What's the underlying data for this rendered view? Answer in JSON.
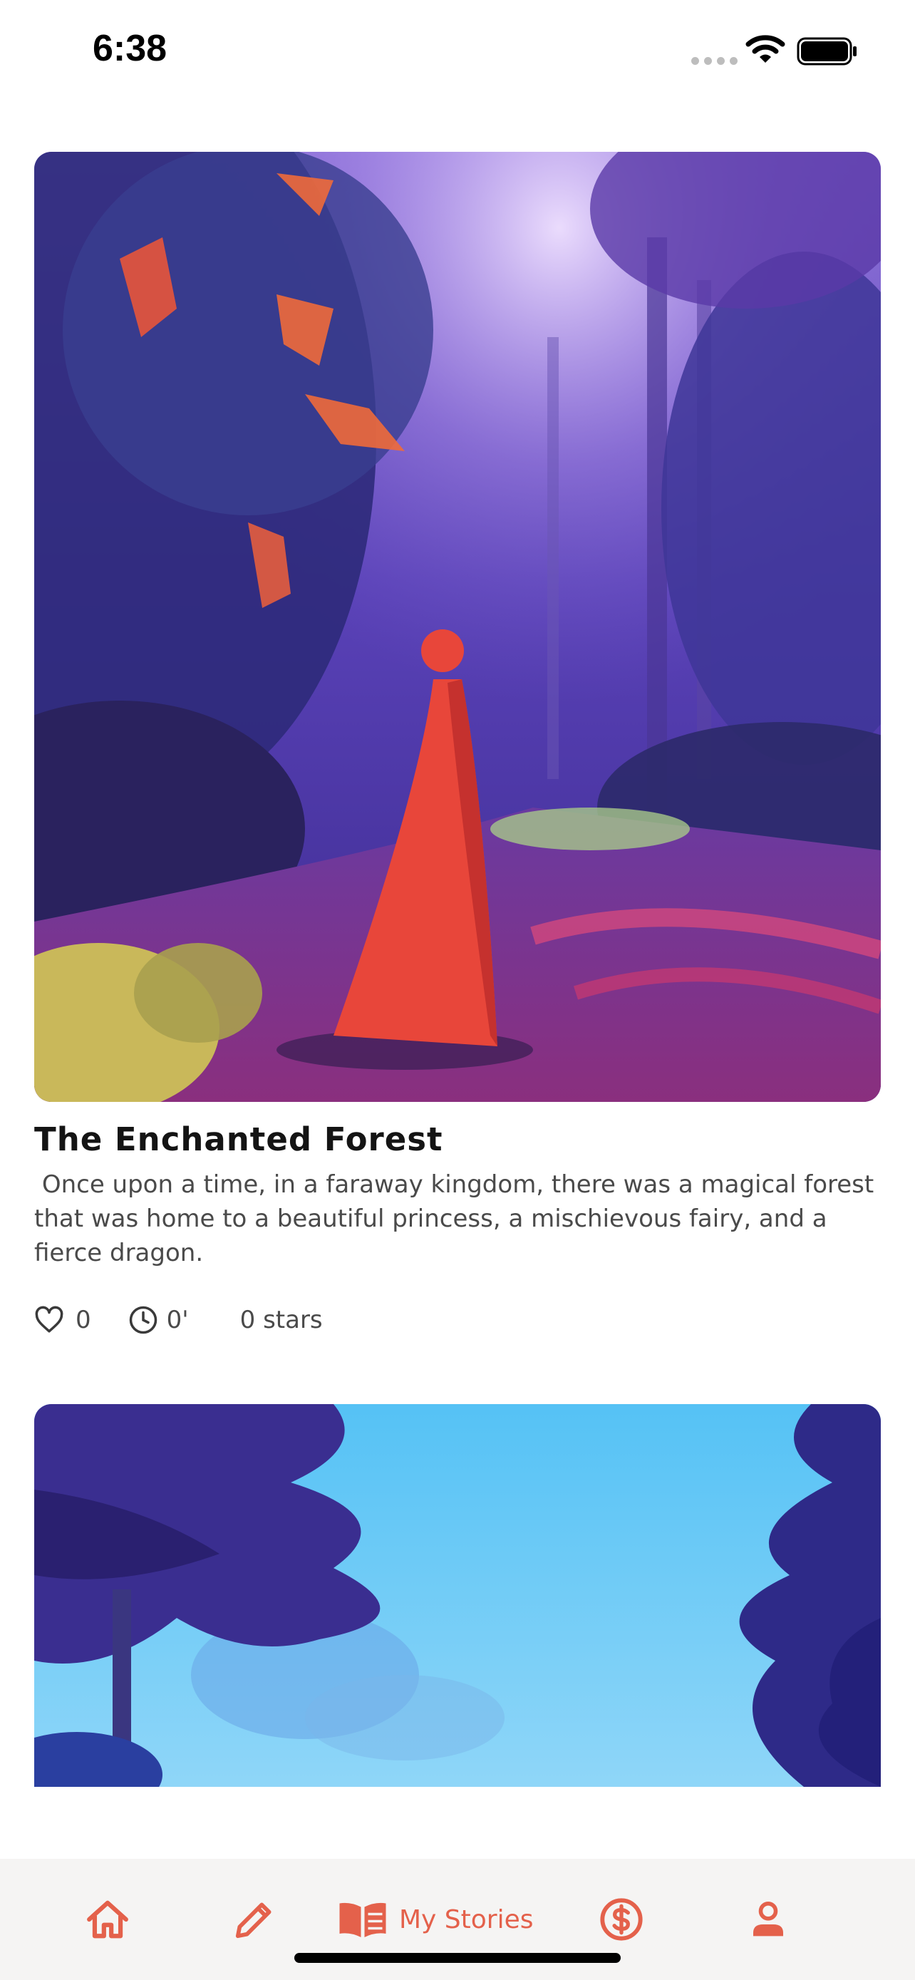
{
  "status_bar": {
    "time": "6:38",
    "icons": [
      "cellular-signal-icon",
      "wifi-icon",
      "battery-icon"
    ]
  },
  "stories": [
    {
      "image": "illustration of a figure in a red cloak standing on a path in a purple enchanted forest",
      "title": "The Enchanted Forest",
      "description": " Once upon a time, in a faraway kingdom, there was a magical forest that was home to a beautiful princess, a mischievous fairy, and a fierce dragon.",
      "likes": "0",
      "duration": "0'",
      "stars": "0 stars"
    },
    {
      "image": "illustration of dark blue trees framing a bright blue sky"
    }
  ],
  "tab_bar": {
    "items": [
      {
        "icon": "home-icon"
      },
      {
        "icon": "pencil-icon"
      },
      {
        "icon": "open-book-icon",
        "label": "My Stories"
      },
      {
        "icon": "dollar-circle-icon"
      },
      {
        "icon": "person-icon"
      }
    ]
  },
  "colors": {
    "accent": "#e4614b",
    "tab_bar_background": "#f5f4f3",
    "text_primary": "#141414",
    "text_secondary": "#4a4a4a"
  }
}
